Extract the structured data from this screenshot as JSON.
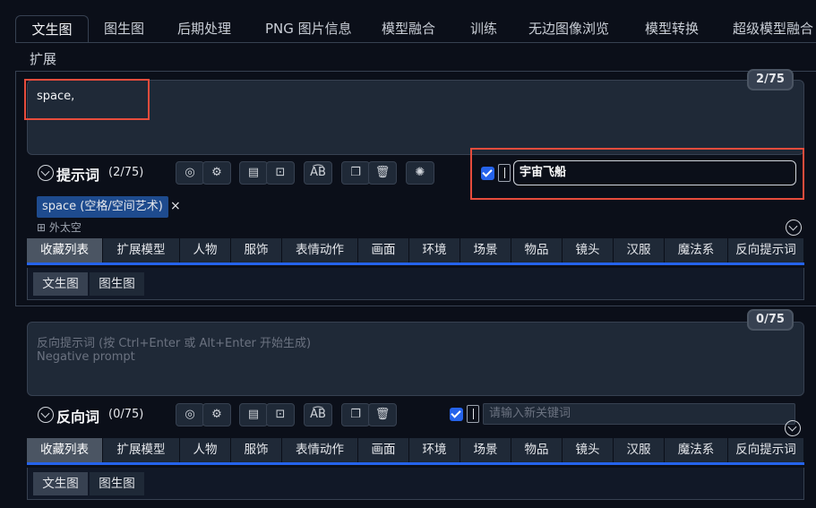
{
  "top_tabs": [
    "文生图",
    "图生图",
    "后期处理",
    "PNG 图片信息",
    "模型融合",
    "训练",
    "无边图像浏览",
    "模型转换",
    "超级模型融合"
  ],
  "tab_row2": "扩展",
  "prompt": {
    "text": "space,",
    "counter": "2/75",
    "section_title": "提示词",
    "section_count": "(2/75)",
    "keyword_value": "宇宙飞船",
    "tag_label": "space (空格/空间艺术)",
    "tag_close": "×",
    "tag_sub": "外太空"
  },
  "negative": {
    "placeholder_line1": "反向提示词 (按 Ctrl+Enter 或 Alt+Enter 开始生成)",
    "placeholder_line2": "Negative prompt",
    "counter": "0/75",
    "section_title": "反向词",
    "section_count": "(0/75)",
    "keyword_placeholder": "请输入新关键词"
  },
  "categories": [
    "收藏列表",
    "扩展模型",
    "人物",
    "服饰",
    "表情动作",
    "画面",
    "环境",
    "场景",
    "物品",
    "镜头",
    "汉服",
    "魔法系",
    "反向提示词"
  ],
  "sub_tabs": [
    "文生图",
    "图生图"
  ],
  "icons": {
    "globe": "globe-icon",
    "gear": "gear-icon",
    "history": "history-icon",
    "bookmark": "bookmark-icon",
    "translate": "translate-icon",
    "copy": "copy-icon",
    "trash": "trash-icon",
    "ai": "openai-icon"
  },
  "colors": {
    "accent": "#2563eb",
    "highlight_box": "#e74c3c",
    "tag_bg": "#1e4b8e"
  }
}
